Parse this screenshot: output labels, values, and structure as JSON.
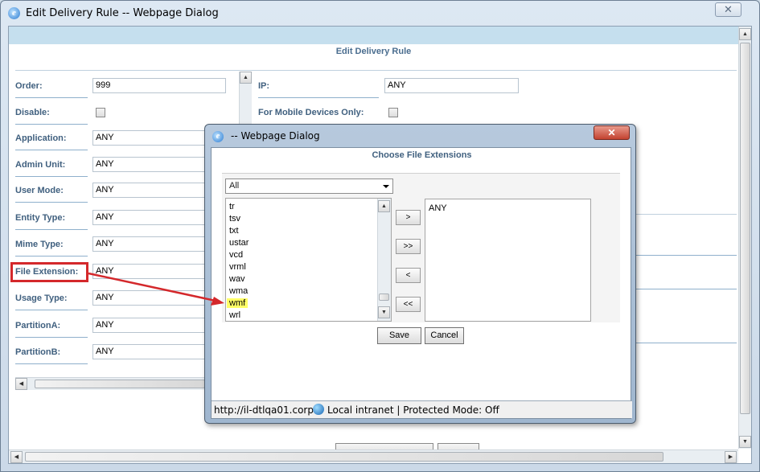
{
  "window": {
    "title": "Edit Delivery Rule -- Webpage Dialog",
    "close_glyph": "✕"
  },
  "page": {
    "heading": "Edit Delivery Rule"
  },
  "form": {
    "order_label": "Order:",
    "order_value": "999",
    "disable_label": "Disable:",
    "application_label": "Application:",
    "application_value": "ANY",
    "admin_unit_label": "Admin Unit:",
    "admin_unit_value": "ANY",
    "user_mode_label": "User Mode:",
    "user_mode_value": "ANY",
    "entity_type_label": "Entity Type:",
    "entity_type_value": "ANY",
    "mime_type_label": "Mime Type:",
    "mime_type_value": "ANY",
    "file_extension_label": "File Extension:",
    "file_extension_value": "ANY",
    "usage_type_label": "Usage Type:",
    "usage_type_value": "ANY",
    "partition_a_label": "PartitionA:",
    "partition_a_value": "ANY",
    "partition_b_label": "PartitionB:",
    "partition_b_value": "ANY",
    "ip_label": "IP:",
    "ip_value": "ANY",
    "mobile_label": "For Mobile Devices Only:"
  },
  "dialog": {
    "title": "-- Webpage Dialog",
    "close_glyph": "✕",
    "heading": "Choose File Extensions",
    "filter_selected": "All",
    "available_items": [
      "tr",
      "tsv",
      "txt",
      "ustar",
      "vcd",
      "vrml",
      "wav",
      "wma",
      "wmf",
      "wrl"
    ],
    "selected_item_highlight": "wmf",
    "chosen_items": [
      "ANY"
    ],
    "add_label": ">",
    "add_all_label": ">>",
    "remove_label": "<",
    "remove_all_label": "<<",
    "save_label": "Save",
    "cancel_label": "Cancel",
    "status_url": "http://il-dtlqa01.corp.",
    "status_zone": "Local intranet | Protected Mode: Off"
  },
  "colors": {
    "highlight": "#ffff66",
    "callout": "#d4282b",
    "label": "#40607f"
  }
}
